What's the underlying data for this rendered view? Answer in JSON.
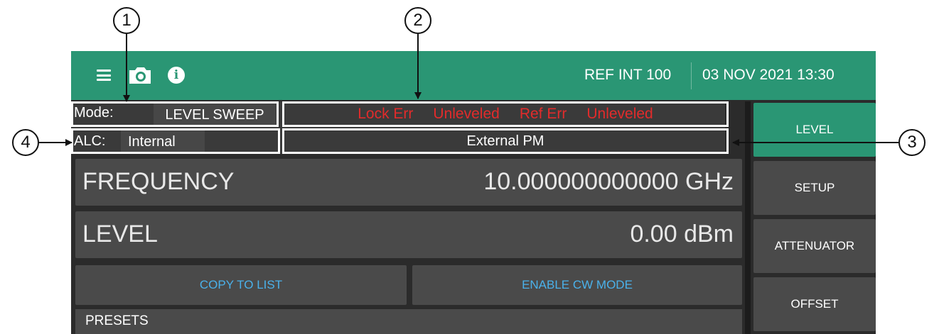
{
  "callouts": [
    "1",
    "2",
    "3",
    "4"
  ],
  "topbar": {
    "icons": [
      "menu-icon",
      "camera-icon",
      "info-icon"
    ],
    "reference": "REF INT 100",
    "datetime": "03 NOV 2021 13:30"
  },
  "mode": {
    "label": "Mode:",
    "value": "LEVEL SWEEP"
  },
  "alc": {
    "label": "ALC:",
    "value": "Internal"
  },
  "status": [
    "Lock Err",
    "Unleveled",
    "Ref Err",
    "Unleveled"
  ],
  "pm_status": "External PM",
  "frequency": {
    "label": "FREQUENCY",
    "value": "10.000000000000",
    "unit": "GHz"
  },
  "level": {
    "label": "LEVEL",
    "value": "0.00",
    "unit": "dBm"
  },
  "buttons": {
    "copy": "COPY TO LIST",
    "cw": "ENABLE CW MODE"
  },
  "presets": "PRESETS",
  "side_menu": [
    "LEVEL",
    "SETUP",
    "ATTENUATOR",
    "OFFSET"
  ],
  "colors": {
    "accent": "#2a9674",
    "error": "#e22b2b",
    "link": "#4ab1ea",
    "panel": "#4a4a4a"
  }
}
